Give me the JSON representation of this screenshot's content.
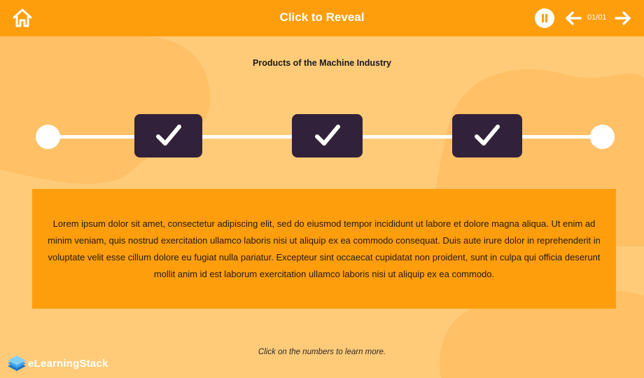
{
  "header": {
    "title": "Click to Reveal",
    "counter": "01/01",
    "icons": {
      "home": "home-icon",
      "pause": "pause-icon",
      "prev": "arrow-left-icon",
      "next": "arrow-right-icon"
    }
  },
  "main": {
    "heading": "Products of the Machine Industry",
    "steps": [
      {
        "icon": "checkmark-icon",
        "state": "revealed"
      },
      {
        "icon": "checkmark-icon",
        "state": "revealed"
      },
      {
        "icon": "checkmark-icon",
        "state": "revealed"
      }
    ],
    "content": "Lorem ipsum dolor sit amet, consectetur adipiscing elit, sed do eiusmod tempor incididunt ut labore et dolore magna aliqua. Ut enim ad minim veniam, quis nostrud exercitation ullamco laboris nisi ut aliquip ex ea commodo consequat. Duis aute irure dolor in reprehenderit in voluptate velit esse cillum dolore eu fugiat nulla pariatur. Excepteur sint occaecat cupidatat non proident, sunt in culpa qui officia deserunt mollit anim id est laborum exercitation ullamco laboris nisi ut aliquip ex ea commodo.",
    "hint": "Click on the numbers to learn more."
  },
  "branding": {
    "logo_text": "eLearningStack"
  },
  "colors": {
    "accent": "#ff9e0d",
    "background": "#ffcb78",
    "step_fill": "#32213a",
    "text_dark": "#231a10"
  }
}
